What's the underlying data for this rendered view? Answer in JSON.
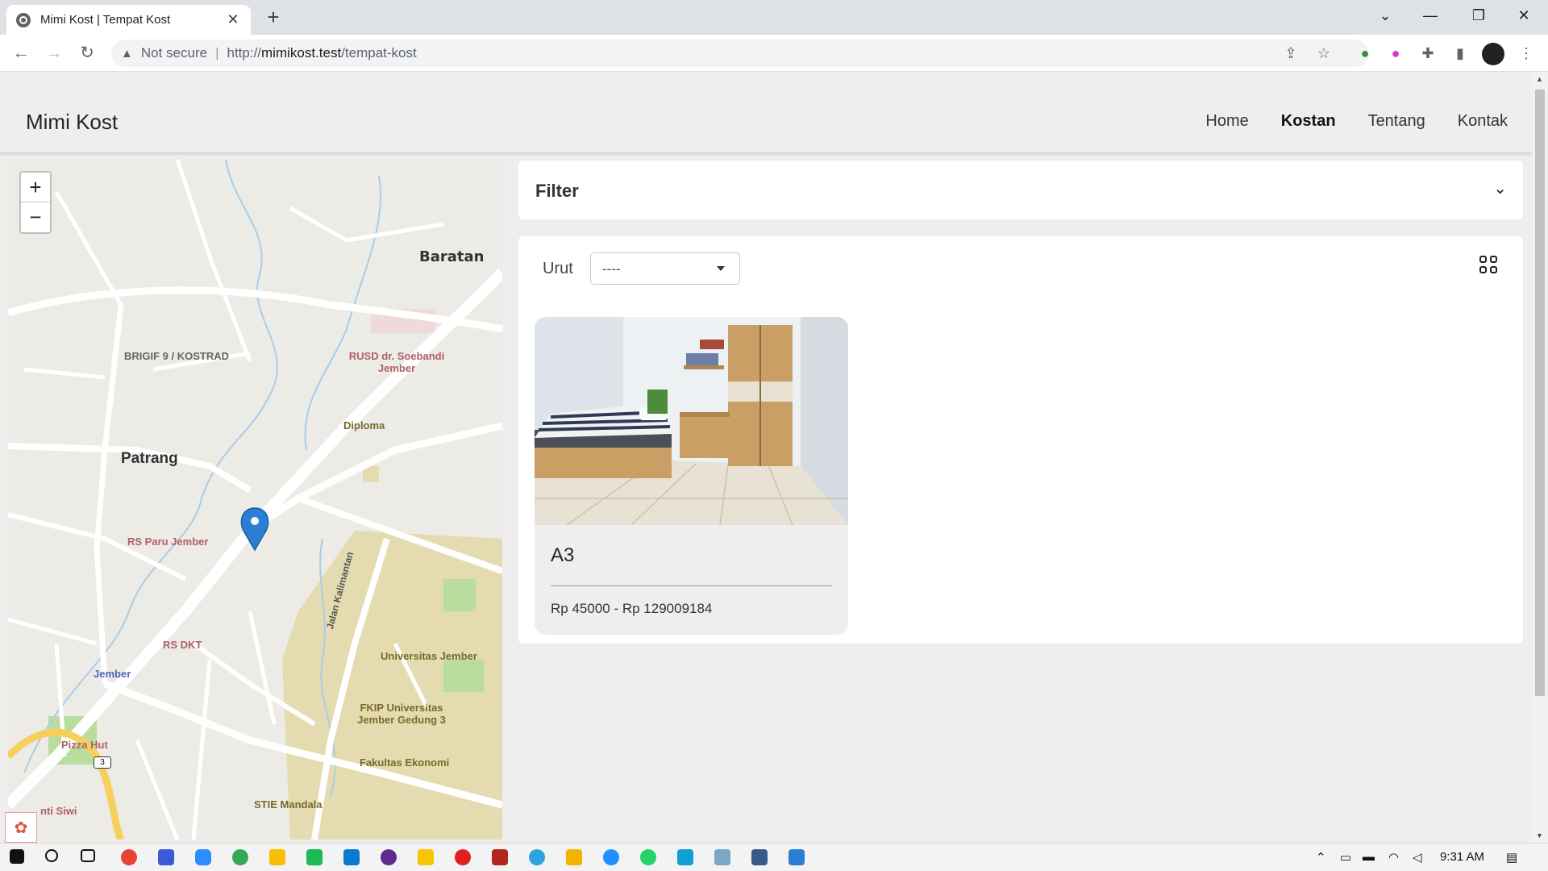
{
  "browser": {
    "tab_title": "Mimi Kost | Tempat Kost",
    "security_label": "Not secure",
    "separator": "|",
    "url_prefix": "http://",
    "url_host": "mimikost.test",
    "url_path": "/tempat-kost"
  },
  "site": {
    "brand": "Mimi Kost",
    "nav": [
      "Home",
      "Kostan",
      "Tentang",
      "Kontak"
    ],
    "active_nav": "Kostan"
  },
  "map": {
    "zoom_in": "+",
    "zoom_out": "−",
    "places": [
      "Baratan",
      "BRIGIF 9 / KOSTRAD",
      "RUSD dr. Soebandi Jember",
      "Diploma",
      "Patrang",
      "RS Paru Jember",
      "Jalan Kalimantan",
      "RS DKT",
      "Jember",
      "Universitas Jember",
      "FKIP Universitas Jember Gedung 3",
      "Pizza Hut",
      "Fakultas Ekonomi",
      "STIE Mandala",
      "nti Siwi",
      "3"
    ]
  },
  "filter": {
    "label": "Filter"
  },
  "results": {
    "sort_label": "Urut",
    "sort_value": "----",
    "listings": [
      {
        "name": "A3",
        "price": "Rp 45000 - Rp 129009184"
      }
    ]
  },
  "taskbar": {
    "clock": "9:31 AM"
  },
  "colors": {
    "map_bg": "#ece9e3",
    "road": "#ffffff",
    "campus": "#e3ddb0",
    "park": "#b7dea0",
    "marker": "#2a7fd4"
  }
}
